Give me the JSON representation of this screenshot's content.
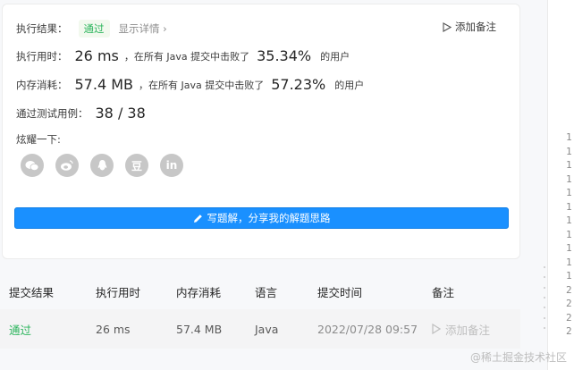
{
  "result": {
    "label": "执行结果：",
    "status": "通过",
    "detail_link": "显示详情 ›",
    "add_note": "添加备注"
  },
  "runtime": {
    "label": "执行用时：",
    "value": "26 ms",
    "prefix": "，在所有 Java 提交中击败了",
    "percent": "35.34%",
    "suffix": "的用户"
  },
  "memory": {
    "label": "内存消耗：",
    "value": "57.4 MB",
    "prefix": "，在所有 Java 提交中击败了",
    "percent": "57.23%",
    "suffix": "的用户"
  },
  "tests": {
    "label": "通过测试用例：",
    "value": "38  /  38"
  },
  "share": {
    "label": "炫耀一下:",
    "icons": [
      "wechat-icon",
      "weibo-icon",
      "qq-icon",
      "douban-icon",
      "linkedin-icon"
    ],
    "douban_glyph": "豆",
    "linkedin_glyph": "in"
  },
  "write_button": "写题解，分享我的解题思路",
  "table": {
    "headers": [
      "提交结果",
      "执行用时",
      "内存消耗",
      "语言",
      "提交时间",
      "备注"
    ],
    "rows": [
      {
        "result": "通过",
        "runtime": "26 ms",
        "memory": "57.4 MB",
        "language": "Java",
        "time": "2022/07/28 09:57",
        "note": "添加备注"
      }
    ]
  },
  "line_numbers": [
    "1",
    "1",
    "1",
    "1",
    "1",
    "1",
    "1",
    "1",
    "1",
    "1",
    "1",
    "2",
    "2",
    "2",
    "2"
  ],
  "watermark": "@稀土掘金技术社区",
  "colors": {
    "accent": "#1a90ff",
    "pass": "#2db55d"
  }
}
